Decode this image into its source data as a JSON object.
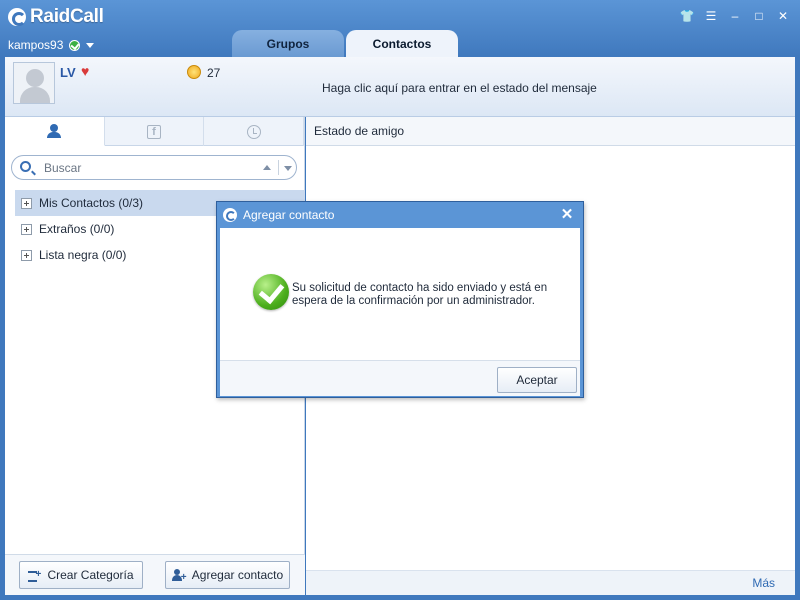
{
  "app": {
    "name": "RaidCall",
    "username": "kampos93"
  },
  "titlebar": {
    "icons": [
      "shirt-icon",
      "notes-icon",
      "minimize-icon",
      "maximize-icon",
      "close-icon"
    ],
    "glyphs": [
      "👕",
      "☰",
      "–",
      "□",
      "✕"
    ]
  },
  "tabs": [
    {
      "label": "Grupos",
      "active": false
    },
    {
      "label": "Contactos",
      "active": true
    }
  ],
  "profile": {
    "nick": "LV",
    "coins": "27",
    "status_message": "Haga clic aquí para entrar en el estado del mensaje"
  },
  "search": {
    "placeholder": "Buscar"
  },
  "groups": [
    {
      "label": "Mis Contactos (0/3)",
      "selected": true
    },
    {
      "label": "Extraños (0/0)",
      "selected": false
    },
    {
      "label": "Lista negra (0/0)",
      "selected": false
    }
  ],
  "left_footer": {
    "create_category": "Crear Categoría",
    "add_contact": "Agregar contacto"
  },
  "right_panel": {
    "header": "Estado de amigo",
    "more": "Más"
  },
  "dialog": {
    "title": "Agregar contacto",
    "message": "Su solicitud de contacto ha sido enviado y está en espera de la confirmación por un administrador.",
    "ok": "Aceptar"
  },
  "colors": {
    "accent": "#3f78bd",
    "selection": "#c9d9ee",
    "success": "#4cae1c"
  }
}
